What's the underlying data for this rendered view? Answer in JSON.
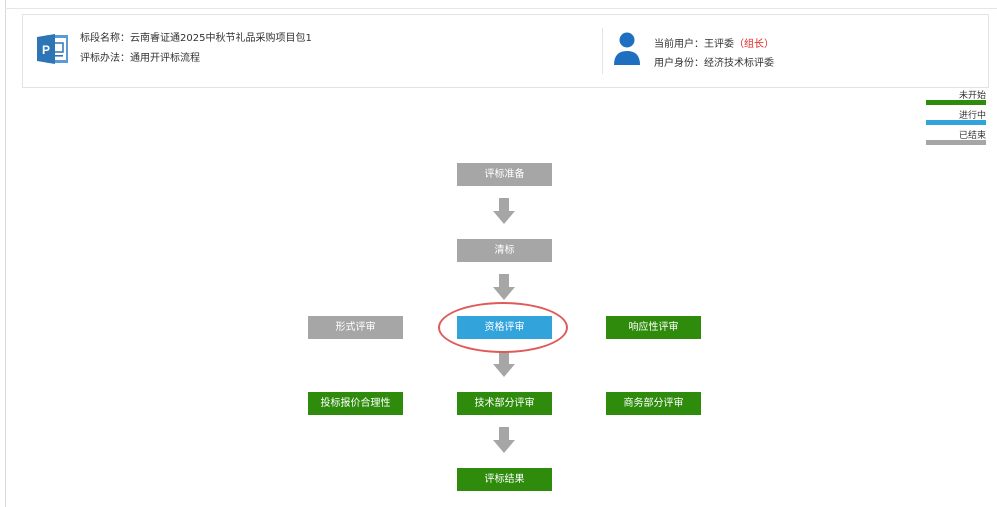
{
  "header": {
    "project_label": "标段名称：",
    "project_name": "云南睿证通2025中秋节礼品采购项目包1",
    "method_label": "评标办法：",
    "method_name": "通用开评标流程",
    "user_label": "当前用户：",
    "user_name": "王评委",
    "user_role": "组长",
    "identity_label": "用户身份：",
    "identity_value": "经济技术标评委"
  },
  "legend": [
    {
      "label": "未开始",
      "color": "#2e8b0c"
    },
    {
      "label": "进行中",
      "color": "#33a3dc"
    },
    {
      "label": "已结束",
      "color": "#a6a6a6"
    }
  ],
  "flow": {
    "prepare": {
      "label": "评标准备",
      "status": "ended"
    },
    "clear": {
      "label": "清标",
      "status": "ended"
    },
    "formal": {
      "label": "形式评审",
      "status": "ended"
    },
    "qualification": {
      "label": "资格评审",
      "status": "in-progress"
    },
    "responsive": {
      "label": "响应性评审",
      "status": "not-started"
    },
    "price": {
      "label": "投标报价合理性",
      "status": "not-started"
    },
    "technical": {
      "label": "技术部分评审",
      "status": "not-started"
    },
    "business": {
      "label": "商务部分评审",
      "status": "not-started"
    },
    "result": {
      "label": "评标结果",
      "status": "not-started"
    }
  },
  "colors": {
    "not_started": "#2e8b0c",
    "in_progress": "#33a3dc",
    "ended": "#a6a6a6",
    "highlight": "#e05a5a"
  }
}
